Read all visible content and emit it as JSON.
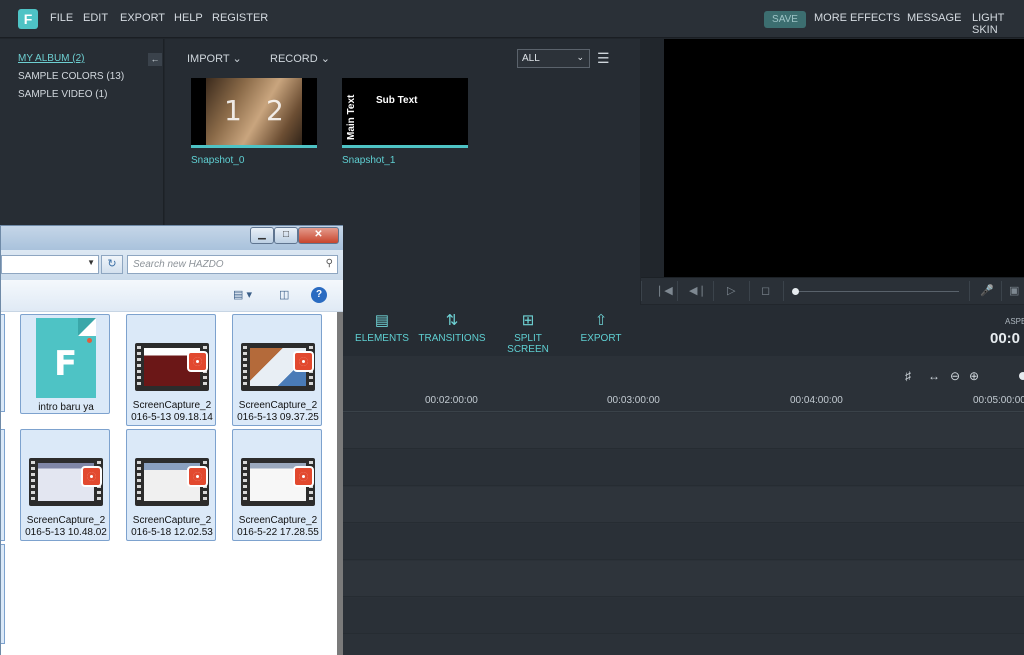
{
  "menu": {
    "items": [
      "FILE",
      "EDIT",
      "EXPORT",
      "HELP",
      "REGISTER"
    ],
    "save": "SAVE",
    "more_effects": "MORE EFFECTS",
    "message": "MESSAGE",
    "light_skin": "LIGHT SKIN",
    "logo": "F"
  },
  "sidebar": {
    "items": [
      {
        "label": "MY ALBUM (2)"
      },
      {
        "label": "SAMPLE COLORS (13)"
      },
      {
        "label": "SAMPLE VIDEO (1)"
      }
    ],
    "collapse_icon": "arrow-left-icon"
  },
  "library": {
    "import": "IMPORT",
    "record": "RECORD",
    "filter_value": "ALL",
    "thumbs": [
      {
        "label": "Snapshot_0",
        "n1": "1",
        "n2": "2"
      },
      {
        "label": "Snapshot_1",
        "main_text": "Main Text",
        "sub_text": "Sub Text"
      }
    ]
  },
  "toolbar": {
    "elements": "ELEMENTS",
    "transitions": "TRANSITIONS",
    "split_screen": "SPLIT SCREEN",
    "export": "EXPORT",
    "aspect": "ASPE",
    "timecode": "00:0"
  },
  "timeline": {
    "ticks": [
      "00:02:00:00",
      "00:03:00:00",
      "00:04:00:00",
      "00:05:00:00"
    ]
  },
  "explorer": {
    "search_placeholder": "Search new HAZDO",
    "files": [
      {
        "name": "intro baru ya",
        "type": "project"
      },
      {
        "name": "ScreenCapture_2016-5-13 09.18.14",
        "l1": "ScreenCapture_2",
        "l2": "016-5-13 09.18.14"
      },
      {
        "name": "ScreenCapture_2016-5-13 09.37.25",
        "l1": "ScreenCapture_2",
        "l2": "016-5-13 09.37.25"
      },
      {
        "name": "ScreenCapture_2016-5-13 10.48.02",
        "l1": "ScreenCapture_2",
        "l2": "016-5-13 10.48.02"
      },
      {
        "name": "ScreenCapture_2016-5-18 12.02.53",
        "l1": "ScreenCapture_2",
        "l2": "016-5-18 12.02.53"
      },
      {
        "name": "ScreenCapture_2016-5-22 17.28.55",
        "l1": "ScreenCapture_2",
        "l2": "016-5-22 17.28.55"
      }
    ]
  }
}
